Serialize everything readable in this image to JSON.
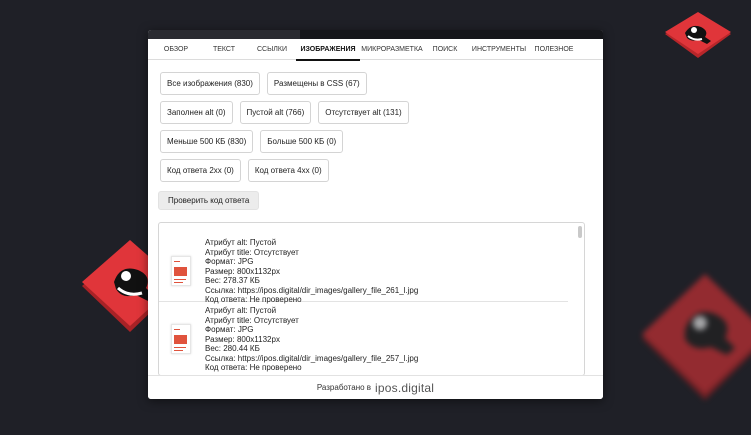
{
  "tabs": [
    {
      "label": "Обзор"
    },
    {
      "label": "Текст"
    },
    {
      "label": "Ссылки"
    },
    {
      "label": "Изображения",
      "active": true
    },
    {
      "label": "Микроразметка"
    },
    {
      "label": "Поиск"
    },
    {
      "label": "Инструменты"
    },
    {
      "label": "Полезное"
    }
  ],
  "filters": {
    "all_images": "Все изображения (830)",
    "in_css": "Размещены в CSS (67)",
    "alt_filled": "Заполнен alt (0)",
    "alt_empty": "Пустой alt (766)",
    "alt_missing": "Отсутствует alt (131)",
    "under_500": "Меньше 500 КБ (830)",
    "over_500": "Больше 500 КБ (0)",
    "code_2xx": "Код ответа 2xx (0)",
    "code_4xx": "Код ответа 4xx (0)"
  },
  "check_button": "Проверить код ответа",
  "results": [
    {
      "alt": "Атрибут alt: Пустой",
      "title": "Атрибут title: Отсутствует",
      "format": "Формат: JPG",
      "size": "Размер: 800x1132px",
      "weight": "Вес: 278.37 КБ",
      "link": "Ссылка: https://ipos.digital/dir_images/gallery_file_261_l.jpg",
      "status": "Код ответа: Не проверено"
    },
    {
      "alt": "Атрибут alt: Пустой",
      "title": "Атрибут title: Отсутствует",
      "format": "Формат: JPG",
      "size": "Размер: 800x1132px",
      "weight": "Вес: 280.44 КБ",
      "link": "Ссылка: https://ipos.digital/dir_images/gallery_file_257_l.jpg",
      "status": "Код ответа: Не проверено"
    }
  ],
  "footer": {
    "label": "Разработано в",
    "brand": "ipos.digital"
  },
  "colors": {
    "background": "#1f2027",
    "logo_red": "#e0353a",
    "accent_red": "#e0533d"
  }
}
